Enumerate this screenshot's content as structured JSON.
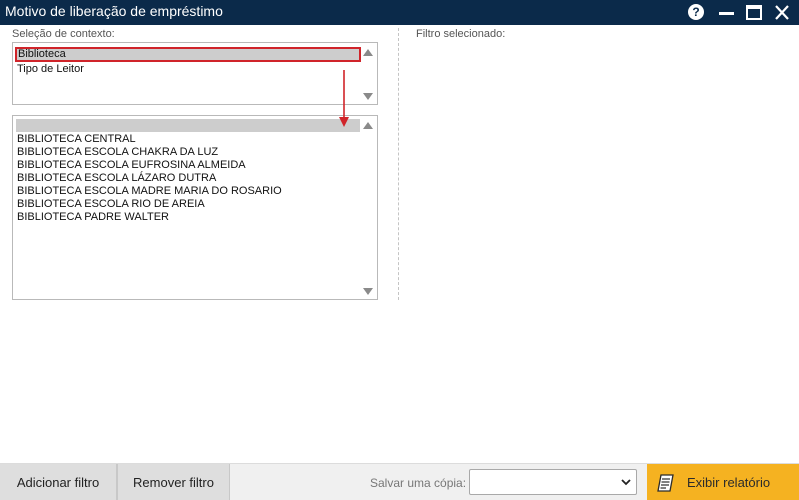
{
  "window": {
    "title": "Motivo de liberação de empréstimo",
    "help_glyph": "?",
    "controls": [
      "help-icon",
      "minimize-icon",
      "maximize-icon",
      "close-icon"
    ]
  },
  "context": {
    "label": "Seleção de contexto:",
    "items": [
      {
        "label": "Biblioteca",
        "selected": true
      },
      {
        "label": "Tipo de Leitor",
        "selected": false
      }
    ]
  },
  "values": {
    "items": [
      "BIBLIOTECA CENTRAL",
      "BIBLIOTECA ESCOLA CHAKRA DA LUZ",
      "BIBLIOTECA ESCOLA EUFROSINA ALMEIDA",
      "BIBLIOTECA ESCOLA LÁZARO DUTRA",
      "BIBLIOTECA ESCOLA MADRE MARIA DO ROSARIO",
      "BIBLIOTECA ESCOLA RIO DE AREIA",
      "BIBLIOTECA PADRE WALTER"
    ]
  },
  "filter": {
    "label": "Filtro selecionado:"
  },
  "footer": {
    "add_filter": "Adicionar filtro",
    "remove_filter": "Remover filtro",
    "save_copy_label": "Salvar uma cópia:",
    "save_copy_value": "",
    "run_report": "Exibir relatório"
  },
  "colors": {
    "titlebar": "#0b2a4a",
    "accent": "#f5b221",
    "selection_outline": "#d0242a",
    "annotation_arrow": "#d0242a"
  }
}
